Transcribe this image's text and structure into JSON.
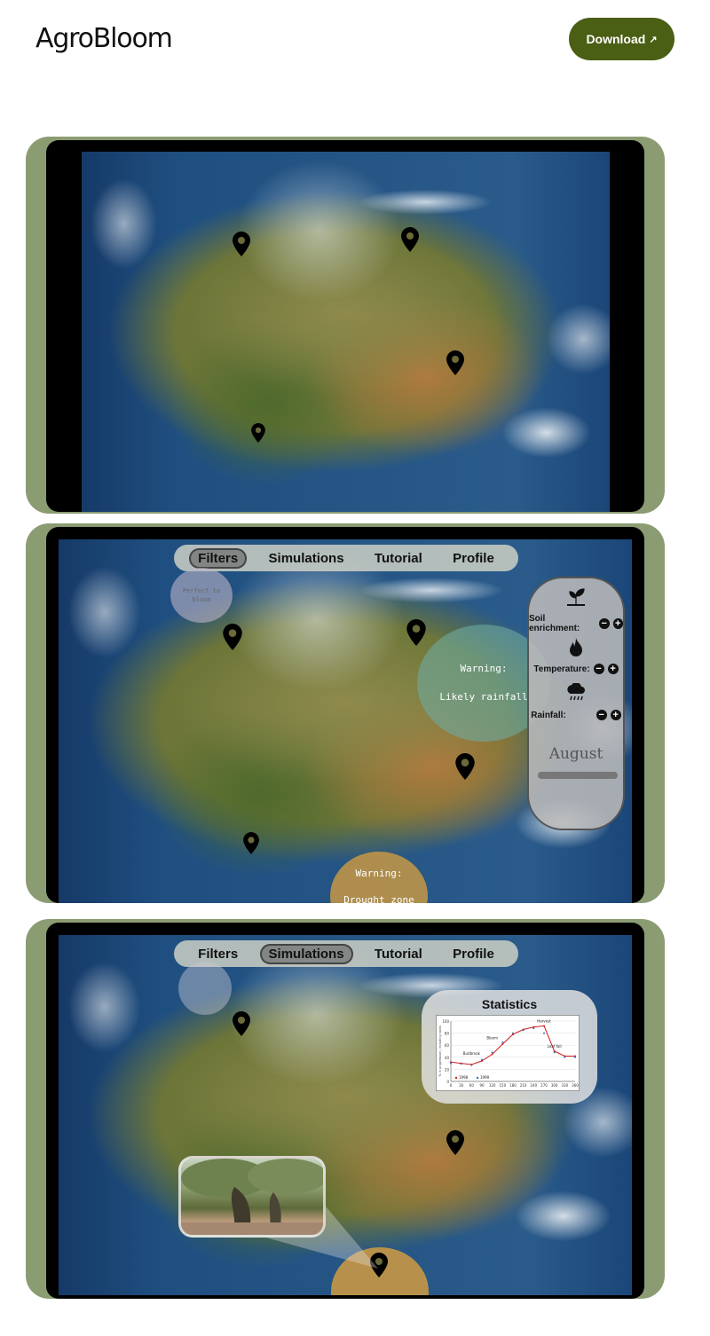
{
  "header": {
    "logo": "AgroBloom",
    "download_label": "Download",
    "download_arrow": "↗",
    "accent_color": "#4a5e14"
  },
  "frames": {
    "frame_color": "#8b9c73"
  },
  "screen2": {
    "nav": [
      "Filters",
      "Simulations",
      "Tutorial",
      "Profile"
    ],
    "active_nav": "Filters",
    "warning_rain": [
      "Warning:",
      "Likely rainfall"
    ],
    "warning_drought": [
      "Warning:",
      "Drought zone"
    ],
    "small_bubble": [
      "Perfect to",
      "bloom"
    ],
    "panel": {
      "soil_label": "Soil enrichment:",
      "temperature_label": "Temperature:",
      "rainfall_label": "Rainfall:",
      "minus": "−",
      "plus": "+",
      "month": "August",
      "icons": [
        "plant-icon",
        "flame-icon",
        "rain-cloud-icon"
      ]
    }
  },
  "screen3": {
    "nav": [
      "Filters",
      "Simulations",
      "Tutorial",
      "Profile"
    ],
    "active_nav": "Simulations",
    "stats_title": "Statistics",
    "chart_data": {
      "type": "line",
      "ylabel": "% in progression, including roots",
      "x": [
        0,
        30,
        60,
        90,
        120,
        150,
        180,
        210,
        240,
        270,
        300,
        330,
        360
      ],
      "ylim": [
        0,
        100
      ],
      "yticks": [
        0,
        20,
        40,
        60,
        80,
        100
      ],
      "annotations": [
        "Budbreak",
        "Bloom",
        "Harvest",
        "Leaf fall"
      ],
      "legend": [
        "1998",
        "1999"
      ],
      "series": [
        {
          "name": "1998",
          "values": [
            32,
            30,
            28,
            34,
            45,
            62,
            78,
            86,
            90,
            92,
            50,
            42,
            42
          ]
        },
        {
          "name": "1999",
          "values": [
            30,
            29,
            27,
            36,
            48,
            65,
            80,
            85,
            88,
            80,
            48,
            40,
            40
          ]
        }
      ]
    }
  }
}
